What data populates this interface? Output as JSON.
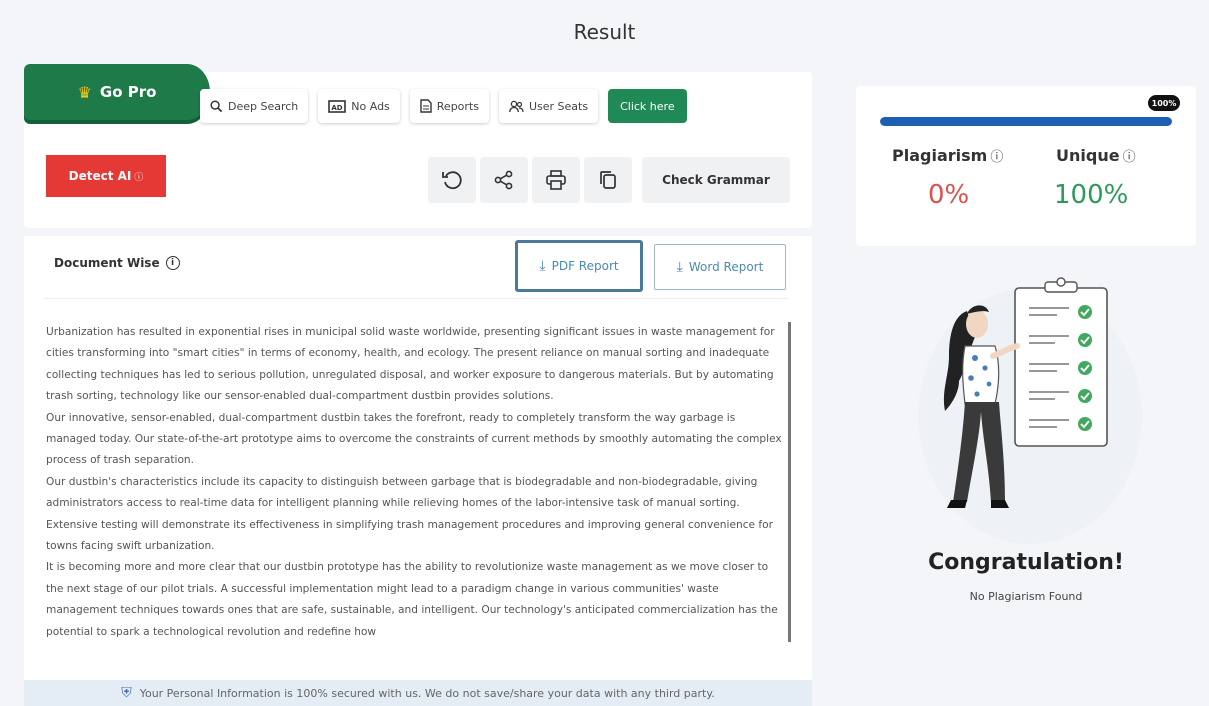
{
  "page": {
    "title": "Result"
  },
  "pro_bar": {
    "go_pro_label": "Go Pro",
    "deep_search_label": "Deep Search",
    "no_ads_label": "No Ads",
    "reports_label": "Reports",
    "user_seats_label": "User Seats",
    "click_here_label": "Click here"
  },
  "toolbar": {
    "detect_ai_label": "Detect AI",
    "check_grammar_label": "Check Grammar"
  },
  "document": {
    "heading": "Document Wise",
    "pdf_report_label": "PDF Report",
    "word_report_label": "Word Report",
    "paragraphs": [
      "Urbanization has resulted in exponential rises in municipal solid waste worldwide, presenting significant issues in waste management for cities transforming into \"smart cities\" in terms of economy, health, and ecology. The present reliance on manual sorting and inadequate collecting techniques has led to serious pollution, unregulated disposal, and worker exposure to dangerous materials. But by automating trash sorting, technology like our sensor-enabled dual-compartment dustbin provides solutions.",
      "Our innovative, sensor-enabled, dual-compartment dustbin takes the forefront, ready to completely transform the way garbage is managed today. Our state-of-the-art prototype aims to overcome the constraints of current methods by smoothly automating the complex process of trash separation.",
      "Our dustbin's characteristics include its capacity to distinguish between garbage that is biodegradable and non-biodegradable, giving administrators access to real-time data for intelligent planning while relieving homes of the labor-intensive task of manual sorting. Extensive testing will demonstrate its effectiveness in simplifying trash management procedures and improving general convenience for towns facing swift urbanization.",
      "It is becoming more and more clear that our dustbin prototype has the ability to revolutionize waste management as we move closer to the next stage of our pilot trials. A successful implementation might lead to a paradigm change in various communities' waste management techniques towards ones that are safe, sustainable, and intelligent. Our technology's anticipated commercialization has the potential to spark a technological revolution and redefine how"
    ]
  },
  "footer": {
    "note": "Your Personal Information is 100% secured with us. We do not save/share your data with any third party."
  },
  "result": {
    "progress_percent": 100,
    "progress_label": "100%",
    "plagiarism_label": "Plagiarism",
    "plagiarism_value": "0%",
    "unique_label": "Unique",
    "unique_value": "100%",
    "congrats": "Congratulation!",
    "no_plagiarism": "No Plagiarism Found"
  },
  "colors": {
    "go_pro": "#1f7a4a",
    "detect_ai": "#e53935",
    "progress": "#1e5fb3",
    "plagiarism": "#d9534f",
    "unique": "#2e9a5a",
    "check_green": "#43a85f"
  },
  "icons": {
    "go_pro": "crown-icon",
    "deep_search": "search-icon",
    "no_ads": "ad-block-icon",
    "reports": "document-icon",
    "user_seats": "users-icon",
    "refresh": "refresh-icon",
    "share": "share-icon",
    "print": "print-icon",
    "copy": "copy-icon",
    "download": "download-icon",
    "info": "info-icon",
    "shield": "shield-icon"
  }
}
